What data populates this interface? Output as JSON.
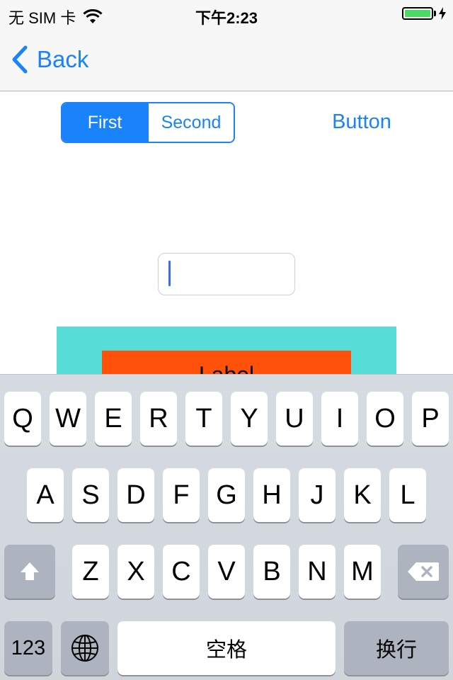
{
  "status_bar": {
    "carrier": "无 SIM 卡",
    "time": "下午2:23",
    "wifi_icon": "wifi-icon",
    "battery_icon": "battery-icon",
    "charging_icon": "charging-bolt-icon",
    "battery_level": 1.0,
    "battery_color": "#4cd964"
  },
  "nav": {
    "back_label": "Back",
    "back_icon": "chevron-left-icon"
  },
  "content": {
    "segments": [
      "First",
      "Second"
    ],
    "selected_segment": "First",
    "button_label": "Button",
    "text_field_value": "",
    "label_text": "Label",
    "colors": {
      "accent": "#1a82fb",
      "teal_box": "#58dcd7",
      "orange_label": "#ff5109"
    }
  },
  "keyboard": {
    "row1": [
      "Q",
      "W",
      "E",
      "R",
      "T",
      "Y",
      "U",
      "I",
      "O",
      "P"
    ],
    "row2": [
      "A",
      "S",
      "D",
      "F",
      "G",
      "H",
      "J",
      "K",
      "L"
    ],
    "row3": [
      "Z",
      "X",
      "C",
      "V",
      "B",
      "N",
      "M"
    ],
    "shift_icon": "shift-icon",
    "delete_icon": "delete-icon",
    "numbers_label": "123",
    "globe_icon": "globe-icon",
    "space_label": "空格",
    "return_label": "换行"
  }
}
